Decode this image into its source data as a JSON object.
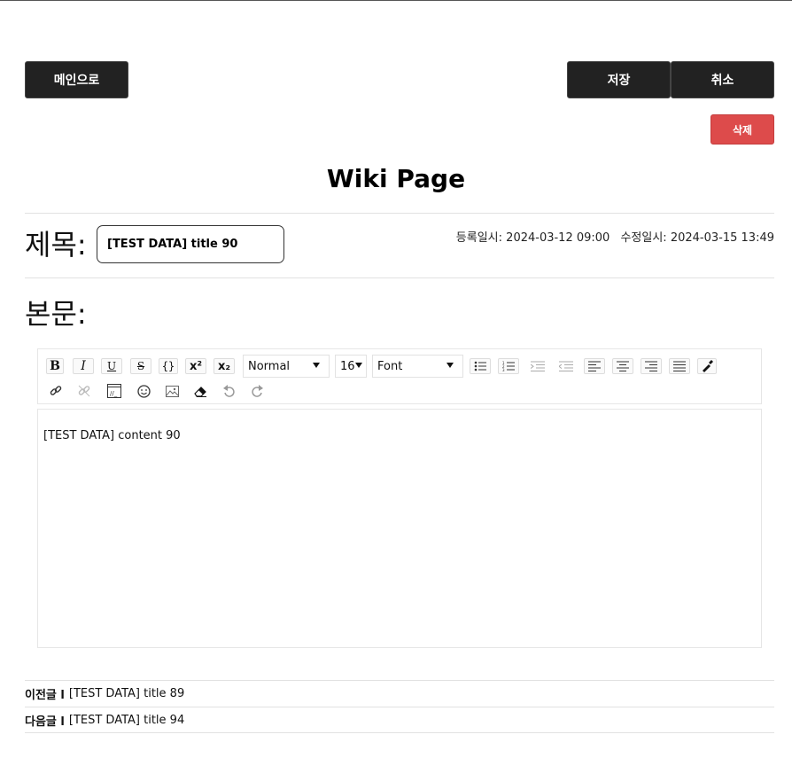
{
  "header": {
    "main_button": "메인으로",
    "save_button": "저장",
    "cancel_button": "취소",
    "delete_button": "삭제"
  },
  "page": {
    "heading": "Wiki Page",
    "title_label": "제목:",
    "title_value": "[TEST DATA] title 90",
    "registered_label": "등록일시:",
    "registered_value": "2024-03-12 09:00",
    "modified_label": "수정일시:",
    "modified_value": "2024-03-15 13:49",
    "body_label": "본문:"
  },
  "toolbar": {
    "header_select": "Normal",
    "size_select": "16",
    "font_select": "Font",
    "icons": [
      "bold-icon",
      "italic-icon",
      "underline-icon",
      "strikethrough-icon",
      "code-block-icon",
      "superscript-icon",
      "subscript-icon",
      "bullet-list-icon",
      "ordered-list-icon",
      "indent-icon",
      "outdent-icon",
      "align-left-icon",
      "align-center-icon",
      "align-right-icon",
      "align-justify-icon",
      "color-picker-icon",
      "link-icon",
      "unlink-icon",
      "html-embed-icon",
      "emoji-icon",
      "image-icon",
      "eraser-icon",
      "undo-icon",
      "redo-icon"
    ]
  },
  "editor": {
    "content": "[TEST DATA] content 90"
  },
  "navigation": {
    "prev_label": "이전글 l",
    "prev_title": "[TEST DATA] title 89",
    "next_label": "다음글 l",
    "next_title": "[TEST DATA] title 94"
  }
}
